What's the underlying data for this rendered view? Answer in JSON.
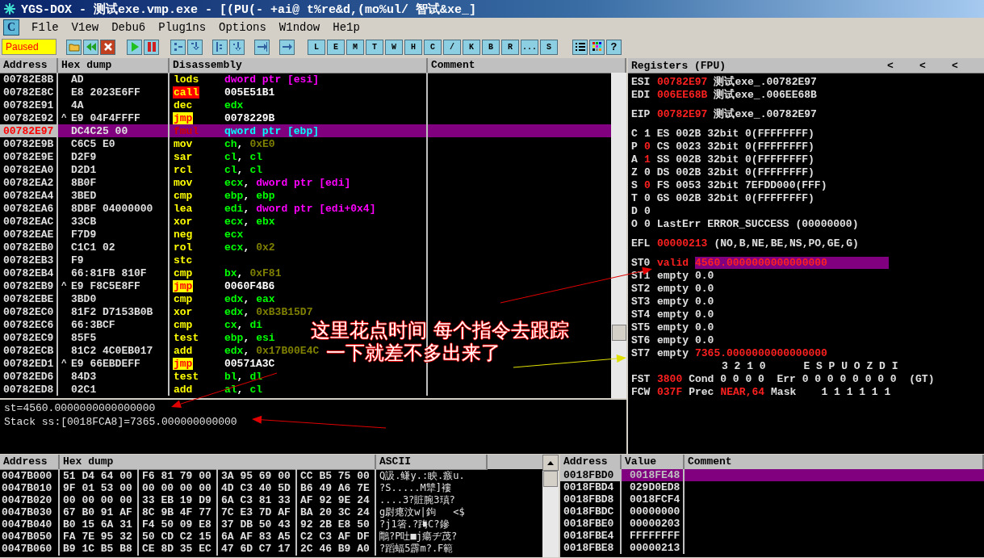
{
  "window": {
    "title": "YGS-DOX - 测试exe.vmp.exe - [(PU(- +ai@ t%re&d,(mo%ul/ 智试&xe_]"
  },
  "menu": {
    "logo": "C",
    "items": [
      "F1le",
      "V1ew",
      "Debu6",
      "Plug1ns",
      "Options",
      "W1ndow",
      "He1p"
    ]
  },
  "toolbar": {
    "status": "Paused",
    "letter_buttons": [
      "L",
      "E",
      "M",
      "T",
      "W",
      "H",
      "C",
      "/",
      "K",
      "B",
      "R",
      "...",
      "S"
    ],
    "help_button": "?"
  },
  "disassembly": {
    "columns": [
      "Address",
      "Hex dump",
      "Disassembly",
      "Comment"
    ],
    "rows": [
      {
        "address": "00782E8B",
        "jump_mark": "",
        "hex": "AD",
        "mnemonic": "lods",
        "kind": "plain",
        "selected": false,
        "operands": [
          {
            "text": "dword ptr [esi]",
            "kind": "mem"
          }
        ]
      },
      {
        "address": "00782E8C",
        "jump_mark": "",
        "hex": "E8 2023E6FF",
        "mnemonic": "call",
        "kind": "call",
        "selected": false,
        "operands": [
          {
            "text": "005E51B1",
            "kind": "addr"
          }
        ]
      },
      {
        "address": "00782E91",
        "jump_mark": "",
        "hex": "4A",
        "mnemonic": "dec",
        "kind": "plain",
        "selected": false,
        "operands": [
          {
            "text": "edx",
            "kind": "reg"
          }
        ]
      },
      {
        "address": "00782E92",
        "jump_mark": "^",
        "hex": "E9 04F4FFFF",
        "mnemonic": "jmp",
        "kind": "jmp",
        "selected": false,
        "operands": [
          {
            "text": "0078229B",
            "kind": "addr"
          }
        ]
      },
      {
        "address": "00782E97",
        "jump_mark": "",
        "hex": "DC4C25 00",
        "mnemonic": "fmul",
        "kind": "plain",
        "selected": true,
        "operands": [
          {
            "text": "qword ptr [ebp]",
            "kind": "mem"
          }
        ]
      },
      {
        "address": "00782E9B",
        "jump_mark": "",
        "hex": "C6C5 E0",
        "mnemonic": "mov",
        "kind": "plain",
        "selected": false,
        "operands": [
          {
            "text": "ch",
            "kind": "reg"
          },
          {
            "text": ",",
            "kind": "sep"
          },
          {
            "text": "0xE0",
            "kind": "const"
          }
        ]
      },
      {
        "address": "00782E9E",
        "jump_mark": "",
        "hex": "D2F9",
        "mnemonic": "sar",
        "kind": "plain",
        "selected": false,
        "operands": [
          {
            "text": "cl",
            "kind": "reg"
          },
          {
            "text": ",",
            "kind": "sep"
          },
          {
            "text": "cl",
            "kind": "reg"
          }
        ]
      },
      {
        "address": "00782EA0",
        "jump_mark": "",
        "hex": "D2D1",
        "mnemonic": "rcl",
        "kind": "plain",
        "selected": false,
        "operands": [
          {
            "text": "cl",
            "kind": "reg"
          },
          {
            "text": ",",
            "kind": "sep"
          },
          {
            "text": "cl",
            "kind": "reg"
          }
        ]
      },
      {
        "address": "00782EA2",
        "jump_mark": "",
        "hex": "8B0F",
        "mnemonic": "mov",
        "kind": "plain",
        "selected": false,
        "operands": [
          {
            "text": "ecx",
            "kind": "reg"
          },
          {
            "text": ",",
            "kind": "sep"
          },
          {
            "text": "dword ptr [edi]",
            "kind": "mem"
          }
        ]
      },
      {
        "address": "00782EA4",
        "jump_mark": "",
        "hex": "3BED",
        "mnemonic": "cmp",
        "kind": "plain",
        "selected": false,
        "operands": [
          {
            "text": "ebp",
            "kind": "reg"
          },
          {
            "text": ",",
            "kind": "sep"
          },
          {
            "text": "ebp",
            "kind": "reg"
          }
        ]
      },
      {
        "address": "00782EA6",
        "jump_mark": "",
        "hex": "8DBF 04000000",
        "mnemonic": "lea",
        "kind": "plain",
        "selected": false,
        "operands": [
          {
            "text": "edi",
            "kind": "reg"
          },
          {
            "text": ",",
            "kind": "sep"
          },
          {
            "text": "dword ptr [edi+0x4]",
            "kind": "mem"
          }
        ]
      },
      {
        "address": "00782EAC",
        "jump_mark": "",
        "hex": "33CB",
        "mnemonic": "xor",
        "kind": "plain",
        "selected": false,
        "operands": [
          {
            "text": "ecx",
            "kind": "reg"
          },
          {
            "text": ",",
            "kind": "sep"
          },
          {
            "text": "ebx",
            "kind": "reg"
          }
        ]
      },
      {
        "address": "00782EAE",
        "jump_mark": "",
        "hex": "F7D9",
        "mnemonic": "neg",
        "kind": "plain",
        "selected": false,
        "operands": [
          {
            "text": "ecx",
            "kind": "reg"
          }
        ]
      },
      {
        "address": "00782EB0",
        "jump_mark": "",
        "hex": "C1C1 02",
        "mnemonic": "rol",
        "kind": "plain",
        "selected": false,
        "operands": [
          {
            "text": "ecx",
            "kind": "reg"
          },
          {
            "text": ",",
            "kind": "sep"
          },
          {
            "text": "0x2",
            "kind": "const"
          }
        ]
      },
      {
        "address": "00782EB3",
        "jump_mark": "",
        "hex": "F9",
        "mnemonic": "stc",
        "kind": "plain",
        "selected": false,
        "operands": []
      },
      {
        "address": "00782EB4",
        "jump_mark": "",
        "hex": "66:81FB 810F",
        "mnemonic": "cmp",
        "kind": "plain",
        "selected": false,
        "operands": [
          {
            "text": "bx",
            "kind": "reg"
          },
          {
            "text": ",",
            "kind": "sep"
          },
          {
            "text": "0xF81",
            "kind": "const"
          }
        ]
      },
      {
        "address": "00782EB9",
        "jump_mark": "^",
        "hex": "E9 F8C5E8FF",
        "mnemonic": "jmp",
        "kind": "jmp",
        "selected": false,
        "operands": [
          {
            "text": "0060F4B6",
            "kind": "addr"
          }
        ]
      },
      {
        "address": "00782EBE",
        "jump_mark": "",
        "hex": "3BD0",
        "mnemonic": "cmp",
        "kind": "plain",
        "selected": false,
        "operands": [
          {
            "text": "edx",
            "kind": "reg"
          },
          {
            "text": ",",
            "kind": "sep"
          },
          {
            "text": "eax",
            "kind": "reg"
          }
        ]
      },
      {
        "address": "00782EC0",
        "jump_mark": "",
        "hex": "81F2 D7153B0B",
        "mnemonic": "xor",
        "kind": "plain",
        "selected": false,
        "operands": [
          {
            "text": "edx",
            "kind": "reg"
          },
          {
            "text": ",",
            "kind": "sep"
          },
          {
            "text": "0xB3B15D7",
            "kind": "const"
          }
        ]
      },
      {
        "address": "00782EC6",
        "jump_mark": "",
        "hex": "66:3BCF",
        "mnemonic": "cmp",
        "kind": "plain",
        "selected": false,
        "operands": [
          {
            "text": "cx",
            "kind": "reg"
          },
          {
            "text": ",",
            "kind": "sep"
          },
          {
            "text": "di",
            "kind": "reg"
          }
        ]
      },
      {
        "address": "00782EC9",
        "jump_mark": "",
        "hex": "85F5",
        "mnemonic": "test",
        "kind": "plain",
        "selected": false,
        "operands": [
          {
            "text": "ebp",
            "kind": "reg"
          },
          {
            "text": ",",
            "kind": "sep"
          },
          {
            "text": "esi",
            "kind": "reg"
          }
        ]
      },
      {
        "address": "00782ECB",
        "jump_mark": "",
        "hex": "81C2 4C0EB017",
        "mnemonic": "add",
        "kind": "plain",
        "selected": false,
        "operands": [
          {
            "text": "edx",
            "kind": "reg"
          },
          {
            "text": ",",
            "kind": "sep"
          },
          {
            "text": "0x17B00E4C",
            "kind": "const"
          }
        ]
      },
      {
        "address": "00782ED1",
        "jump_mark": "^",
        "hex": "E9 66EBDEFF",
        "mnemonic": "jmp",
        "kind": "jmp",
        "selected": false,
        "operands": [
          {
            "text": "00571A3C",
            "kind": "addr"
          }
        ]
      },
      {
        "address": "00782ED6",
        "jump_mark": "",
        "hex": "84D3",
        "mnemonic": "test",
        "kind": "plain",
        "selected": false,
        "operands": [
          {
            "text": "bl",
            "kind": "reg"
          },
          {
            "text": ",",
            "kind": "sep"
          },
          {
            "text": "dl",
            "kind": "reg"
          }
        ]
      },
      {
        "address": "00782ED8",
        "jump_mark": "",
        "hex": "02C1",
        "mnemonic": "add",
        "kind": "plain",
        "selected": false,
        "operands": [
          {
            "text": "al",
            "kind": "reg"
          },
          {
            "text": ",",
            "kind": "sep"
          },
          {
            "text": "cl",
            "kind": "reg"
          }
        ]
      }
    ]
  },
  "info": [
    "st=4560.0000000000000000",
    "Stack ss:[0018FCA8]=7365.000000000000"
  ],
  "registers": {
    "title": "Registers (FPU)",
    "nav": [
      "<",
      "<",
      "<"
    ],
    "groups": [
      {
        "lines": [
          {
            "segments": [
              {
                "text": "ESI",
                "kind": "name"
              },
              {
                "text": "00782E97",
                "kind": "value"
              },
              {
                "text": "测试exe_.00782E97",
                "kind": "text"
              }
            ]
          },
          {
            "segments": [
              {
                "text": "EDI",
                "kind": "name"
              },
              {
                "text": "006EE68B",
                "kind": "value"
              },
              {
                "text": "测试exe_.006EE68B",
                "kind": "text"
              }
            ]
          }
        ]
      },
      {
        "lines": [
          {
            "segments": [
              {
                "text": "EIP",
                "kind": "name"
              },
              {
                "text": "00782E97",
                "kind": "value"
              },
              {
                "text": "测试exe_.00782E97",
                "kind": "text"
              }
            ]
          }
        ]
      },
      {
        "lines": [
          {
            "segments": [
              {
                "text": "C",
                "kind": "flag"
              },
              {
                "text": "1",
                "kind": "text"
              },
              {
                "text": "ES 002B 32bit 0(FFFFFFFF)",
                "kind": "text"
              }
            ]
          },
          {
            "segments": [
              {
                "text": "P",
                "kind": "flag"
              },
              {
                "text": "0",
                "kind": "value"
              },
              {
                "text": "CS 0023 32bit 0(FFFFFFFF)",
                "kind": "text"
              }
            ]
          },
          {
            "segments": [
              {
                "text": "A",
                "kind": "flag"
              },
              {
                "text": "1",
                "kind": "value"
              },
              {
                "text": "SS 002B 32bit 0(FFFFFFFF)",
                "kind": "text"
              }
            ]
          },
          {
            "segments": [
              {
                "text": "Z",
                "kind": "flag"
              },
              {
                "text": "0",
                "kind": "text"
              },
              {
                "text": "DS 002B 32bit 0(FFFFFFFF)",
                "kind": "text"
              }
            ]
          },
          {
            "segments": [
              {
                "text": "S",
                "kind": "flag"
              },
              {
                "text": "0",
                "kind": "value"
              },
              {
                "text": "FS 0053 32bit 7EFDD000(FFF)",
                "kind": "text"
              }
            ]
          },
          {
            "segments": [
              {
                "text": "T",
                "kind": "flag"
              },
              {
                "text": "0",
                "kind": "text"
              },
              {
                "text": "GS 002B 32bit 0(FFFFFFFF)",
                "kind": "text"
              }
            ]
          },
          {
            "segments": [
              {
                "text": "D",
                "kind": "flag"
              },
              {
                "text": "0",
                "kind": "text"
              }
            ]
          },
          {
            "segments": [
              {
                "text": "O",
                "kind": "flag"
              },
              {
                "text": "0",
                "kind": "text"
              },
              {
                "text": "LastErr ERROR_SUCCESS (00000000)",
                "kind": "text"
              }
            ]
          }
        ]
      },
      {
        "lines": [
          {
            "segments": [
              {
                "text": "EFL",
                "kind": "name"
              },
              {
                "text": "00000213",
                "kind": "value"
              },
              {
                "text": "(NO,B,NE,BE,NS,PO,GE,G)",
                "kind": "text"
              }
            ]
          }
        ]
      },
      {
        "lines": [
          {
            "segments": [
              {
                "text": "ST0",
                "kind": "name"
              },
              {
                "text": "valid",
                "kind": "value"
              },
              {
                "text": "4560.0000000000000000",
                "kind": "marked"
              }
            ]
          },
          {
            "segments": [
              {
                "text": "ST1",
                "kind": "name"
              },
              {
                "text": "empty",
                "kind": "text"
              },
              {
                "text": "0.0",
                "kind": "text"
              }
            ]
          },
          {
            "segments": [
              {
                "text": "ST2",
                "kind": "name"
              },
              {
                "text": "empty",
                "kind": "text"
              },
              {
                "text": "0.0",
                "kind": "text"
              }
            ]
          },
          {
            "segments": [
              {
                "text": "ST3",
                "kind": "name"
              },
              {
                "text": "empty",
                "kind": "text"
              },
              {
                "text": "0.0",
                "kind": "text"
              }
            ]
          },
          {
            "segments": [
              {
                "text": "ST4",
                "kind": "name"
              },
              {
                "text": "empty",
                "kind": "text"
              },
              {
                "text": "0.0",
                "kind": "text"
              }
            ]
          },
          {
            "segments": [
              {
                "text": "ST5",
                "kind": "name"
              },
              {
                "text": "empty",
                "kind": "text"
              },
              {
                "text": "0.0",
                "kind": "text"
              }
            ]
          },
          {
            "segments": [
              {
                "text": "ST6",
                "kind": "name"
              },
              {
                "text": "empty",
                "kind": "text"
              },
              {
                "text": "0.0",
                "kind": "text"
              }
            ]
          },
          {
            "segments": [
              {
                "text": "ST7",
                "kind": "name"
              },
              {
                "text": "empty",
                "kind": "text"
              },
              {
                "text": "7365.0000000000000000",
                "kind": "value"
              }
            ]
          },
          {
            "segments": [
              {
                "text": "3 2 1 0      E S P U O Z D I",
                "kind": "indent"
              }
            ]
          },
          {
            "segments": [
              {
                "text": "FST",
                "kind": "name"
              },
              {
                "text": "3800",
                "kind": "value"
              },
              {
                "text": "Cond 0 0 0 0  Err 0 0 0 0 0 0 0 0  (GT)",
                "kind": "text"
              }
            ]
          },
          {
            "segments": [
              {
                "text": "FCW",
                "kind": "name"
              },
              {
                "text": "037F",
                "kind": "value"
              },
              {
                "text": "Prec",
                "kind": "text"
              },
              {
                "text": "NEAR,64",
                "kind": "value"
              },
              {
                "text": "Mask    1 1 1 1 1 1",
                "kind": "text"
              }
            ]
          }
        ]
      }
    ]
  },
  "dump": {
    "columns": [
      "Address",
      "Hex dump",
      "ASCII"
    ],
    "rows": [
      {
        "address": "0047B000",
        "groups": [
          "51 D4 64 00",
          "F6 81 79 00",
          "3A 95 69 00",
          "CC B5 75 00"
        ],
        "ascii": "Q訯.鳒y.:眏.瘯u."
      },
      {
        "address": "0047B010",
        "groups": [
          "9F 01 53 00",
          "00 00 00 00",
          "4D C3 40 5D",
          "B6 49 A6 7E"
        ],
        "ascii": "?S.....M犨]褸"
      },
      {
        "address": "0047B020",
        "groups": [
          "00 00 00 00",
          "33 EB 19 D9",
          "6A C3 81 33",
          "AF 92 9E 24"
        ],
        "ascii": "....3?賍腕3瑱?"
      },
      {
        "address": "0047B030",
        "groups": [
          "67 B0 91 AF",
          "8C 9B 4F 77",
          "7C E3 7D AF",
          "BA 20 3C 24"
        ],
        "ascii": "g尉瘪汶w|鉤   <$"
      },
      {
        "address": "0047B040",
        "groups": [
          "B0 15 6A 31",
          "F4 50 09 E8",
          "37 DB 50 43",
          "92 2B E8 50"
        ],
        "ascii": "?j1箵.?踇C?鏒"
      },
      {
        "address": "0047B050",
        "groups": [
          "FA 7E 95 32",
          "50 CD C2 15",
          "6A AF 83 A5",
          "C2 C3 AF DF"
        ],
        "ascii": "鷼?P吐■j瘍ヂ茂?"
      },
      {
        "address": "0047B060",
        "groups": [
          "B9 1C B5 B8",
          "CE 8D 35 EC",
          "47 6D C7 17",
          "2C 46 B9 A0"
        ],
        "ascii": "?蹈蝠5霹m?.F範"
      }
    ]
  },
  "stack": {
    "columns": [
      "Address",
      "Value",
      "Comment"
    ],
    "rows": [
      {
        "address": "0018FBD0",
        "value": "0018FE48",
        "selected": true
      },
      {
        "address": "0018FBD4",
        "value": "029D0ED8",
        "selected": false
      },
      {
        "address": "0018FBD8",
        "value": "0018FCF4",
        "selected": false
      },
      {
        "address": "0018FBDC",
        "value": "00000000",
        "selected": false
      },
      {
        "address": "0018FBE0",
        "value": "00000203",
        "selected": false
      },
      {
        "address": "0018FBE4",
        "value": "FFFFFFFF",
        "selected": false
      },
      {
        "address": "0018FBE8",
        "value": "00000213",
        "selected": false
      }
    ]
  },
  "annotation": {
    "lines": [
      "这里花点时间 每个指令去跟踪",
      "一下就差不多出来了"
    ]
  }
}
